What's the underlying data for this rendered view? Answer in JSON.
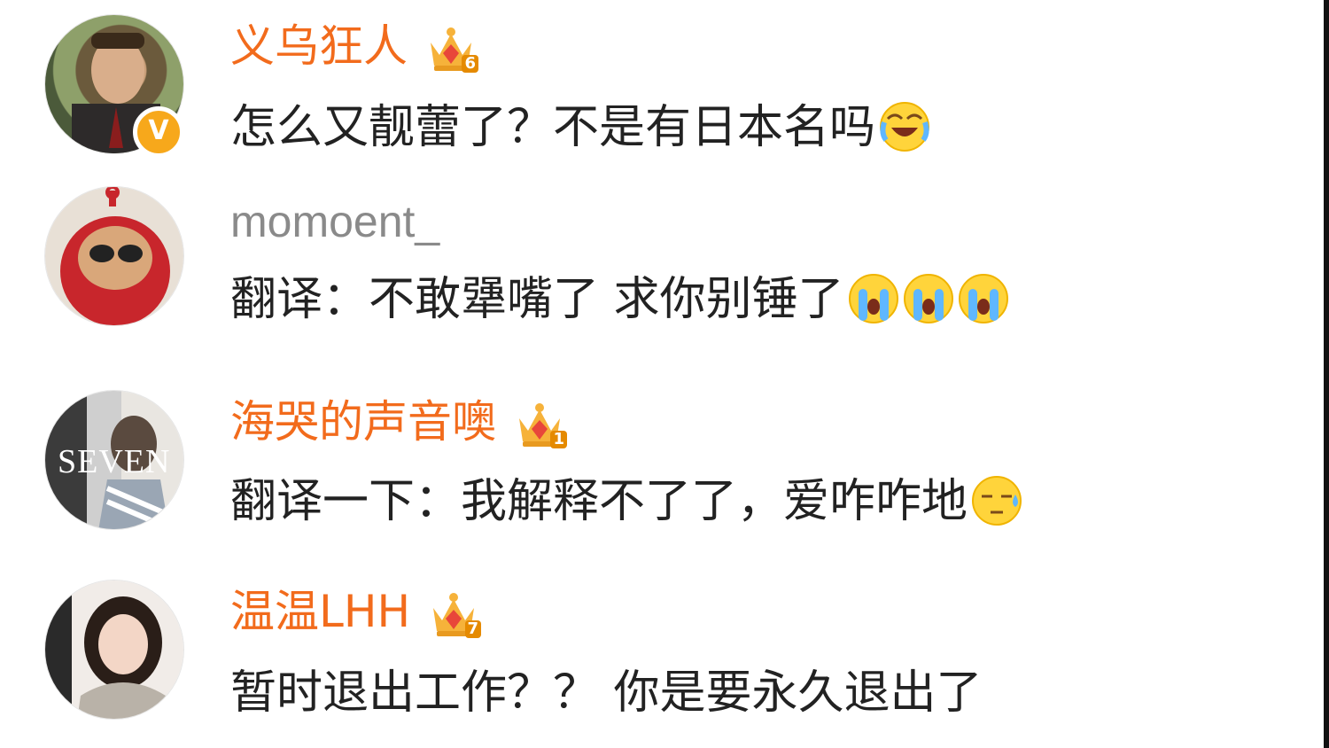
{
  "comments": [
    {
      "username": "义乌狂人",
      "level": "6",
      "verified_badge": "V",
      "text": "怎么又靓蕾了？不是有日本名吗",
      "emojis": [
        "laugh-cry-emoji"
      ]
    },
    {
      "username": "momoent_",
      "text": "翻译：不敢犟嘴了 求你别锤了",
      "emojis": [
        "crying-emoji",
        "crying-emoji",
        "crying-emoji"
      ]
    },
    {
      "username": "海哭的声音噢",
      "level": "1",
      "avatar_text": "SEVEN",
      "text": "翻译一下：我解释不了了，爱咋咋地",
      "emojis": [
        "sweat-emoji"
      ]
    },
    {
      "username": "温温LHH",
      "level": "7",
      "text": "暂时退出工作？？ 你是要永久退出了",
      "emojis": []
    }
  ],
  "colors": {
    "vip_name": "#f26b1c",
    "plain_name": "#8a8a8a",
    "text": "#222222",
    "badge": "#f7a81b"
  }
}
